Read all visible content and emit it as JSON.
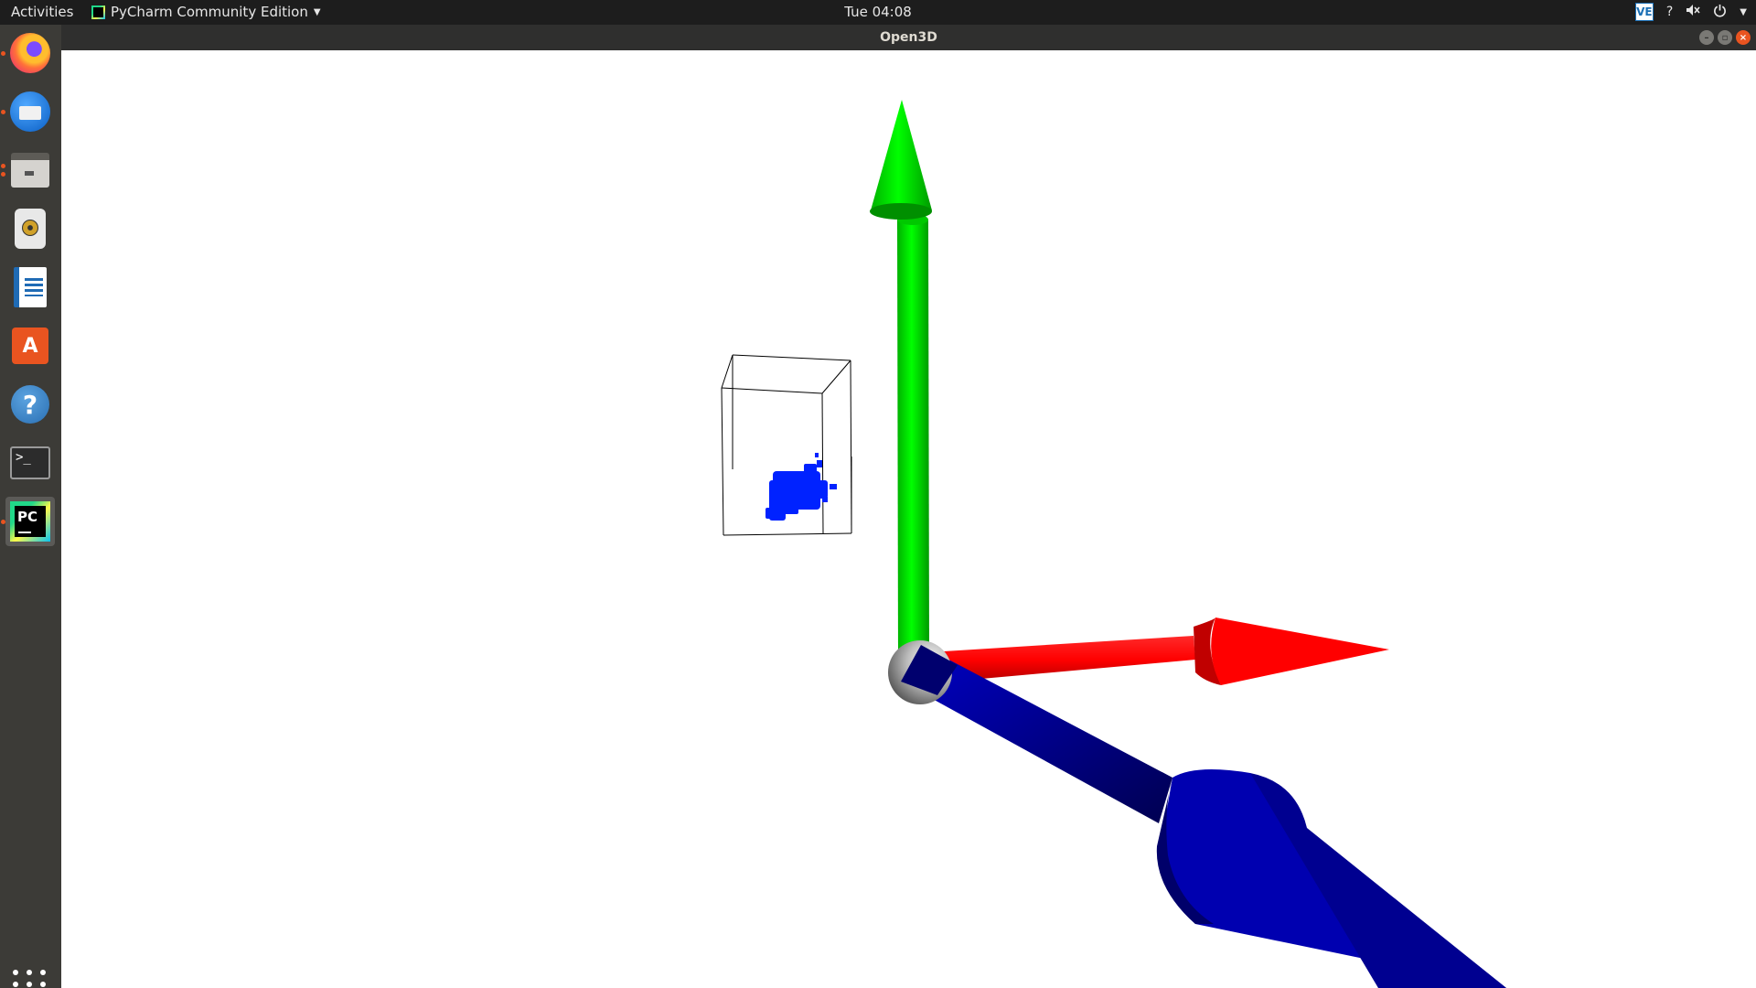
{
  "top_bar": {
    "activities": "Activities",
    "app_menu": "PyCharm Community Edition",
    "clock": "Tue 04:08",
    "tray_ve": "VE",
    "tray_icons": [
      "help-icon",
      "volume-muted-icon",
      "power-icon",
      "chevron-down-icon"
    ]
  },
  "dock": {
    "items": [
      {
        "name": "firefox",
        "icon": "firefox-icon",
        "running": true
      },
      {
        "name": "thunderbird",
        "icon": "mail-icon",
        "running": true
      },
      {
        "name": "files",
        "icon": "files-icon",
        "running": true
      },
      {
        "name": "rhythmbox",
        "icon": "music-icon",
        "running": false
      },
      {
        "name": "libreoffice-writer",
        "icon": "writer-icon",
        "running": false
      },
      {
        "name": "ubuntu-software",
        "icon": "software-store-icon",
        "running": false
      },
      {
        "name": "help",
        "icon": "help-icon",
        "running": false
      },
      {
        "name": "terminal",
        "icon": "terminal-icon",
        "running": false
      },
      {
        "name": "pycharm",
        "icon": "pycharm-icon",
        "running": true,
        "active": true
      }
    ],
    "pycharm_label": "PC",
    "terminal_prompt": ">_",
    "store_glyph": "A",
    "help_glyph": "?"
  },
  "window": {
    "title": "Open3D",
    "controls": {
      "minimize": "–",
      "maximize": "▫",
      "close": "×"
    }
  },
  "scene": {
    "axis_colors": {
      "x": "#ff0000",
      "y": "#00ff00",
      "z": "#0000b0",
      "origin": "#9a9a9a"
    },
    "point_cloud_color": "#0022ff",
    "bounding_box_color": "#000000"
  },
  "colors": {
    "top_bar": "#1d1d1d",
    "dock": "#3c3b37",
    "accent": "#e95420",
    "title_bar": "#2f2f2e"
  }
}
